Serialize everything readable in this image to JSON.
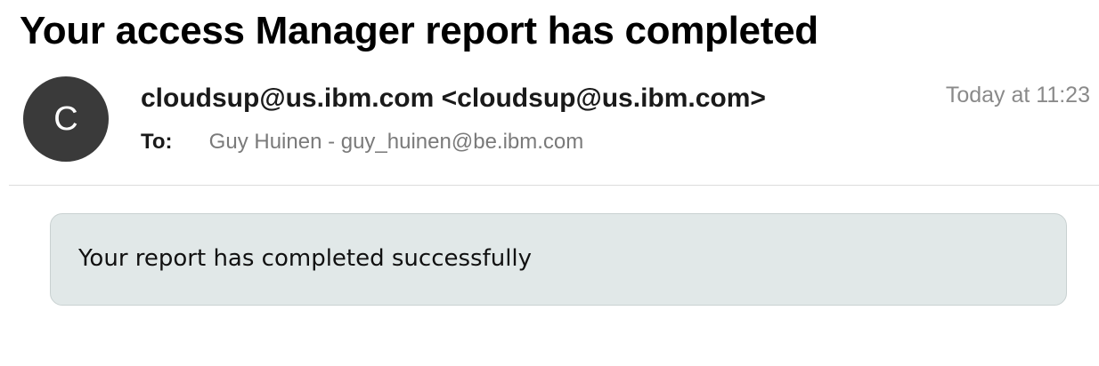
{
  "email": {
    "subject": "Your access Manager report has completed",
    "avatar_initial": "C",
    "from": "cloudsup@us.ibm.com <cloudsup@us.ibm.com>",
    "timestamp": "Today at 11:23",
    "to_label": "To:",
    "to_value": "Guy Huinen - guy_huinen@be.ibm.com",
    "body_text": "Your report has completed successfully"
  }
}
